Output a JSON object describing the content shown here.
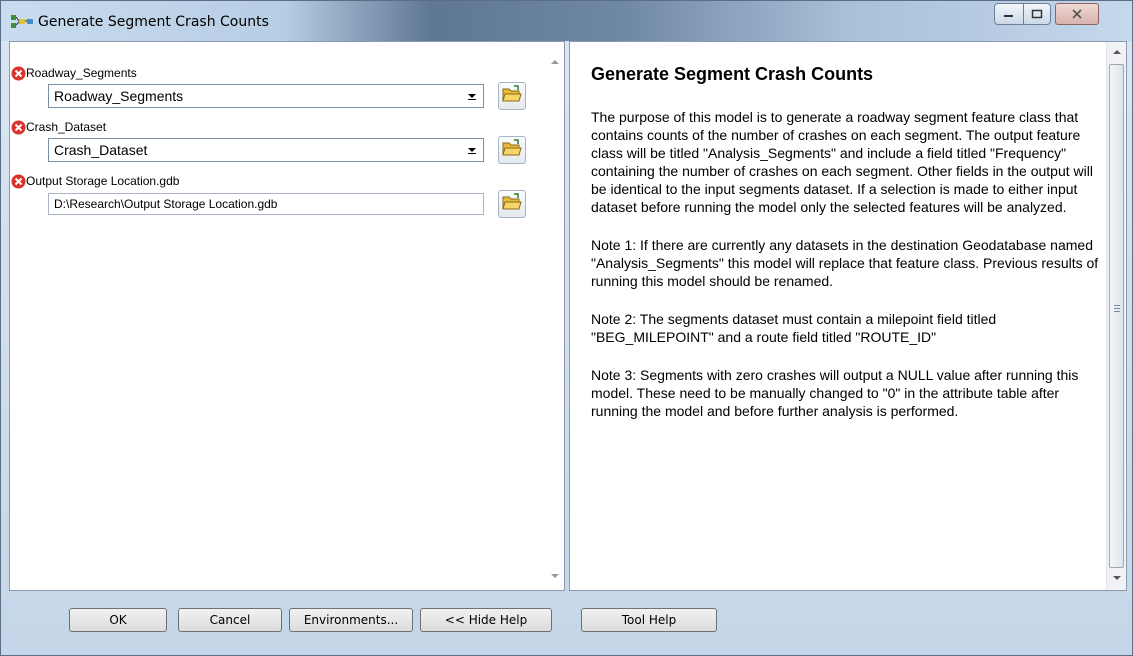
{
  "window": {
    "title": "Generate Segment Crash Counts"
  },
  "params": [
    {
      "label": "Roadway_Segments",
      "value": "Roadway_Segments",
      "type": "combo"
    },
    {
      "label": "Crash_Dataset",
      "value": "Crash_Dataset",
      "type": "combo"
    },
    {
      "label": "Output Storage Location.gdb",
      "value": "D:\\Research\\Output Storage Location.gdb",
      "type": "text"
    }
  ],
  "help": {
    "title": "Generate Segment Crash Counts",
    "paragraphs": [
      "The purpose of this model is to generate a roadway segment feature class that contains counts of the number of crashes on each segment. The output feature class will be titled \"Analysis_Segments\" and include a field titled \"Frequency\" containing the number of crashes on each segment. Other fields in the output will be identical to the input segments dataset. If a selection is made to either input dataset before running the model only the selected features will be analyzed.",
      "Note 1: If there are currently any datasets in the destination Geodatabase named \"Analysis_Segments\" this model will replace that feature class. Previous results of running this model should be renamed.",
      "Note 2: The segments dataset must contain a milepoint field titled \"BEG_MILEPOINT\" and a route field titled \"ROUTE_ID\"",
      "Note 3: Segments with zero crashes will output a NULL value after running this model. These need to be manually changed to \"0\" in the attribute table after running the model and before further analysis is performed."
    ]
  },
  "buttons": {
    "ok": "OK",
    "cancel": "Cancel",
    "environments": "Environments...",
    "hide_help": "<< Hide Help",
    "tool_help": "Tool Help"
  },
  "colors": {
    "error": "#d9342b",
    "folder": "#e8b93a"
  },
  "icons": {
    "app": "model-icon",
    "error": "error-x-icon",
    "browse": "folder-open-icon"
  }
}
